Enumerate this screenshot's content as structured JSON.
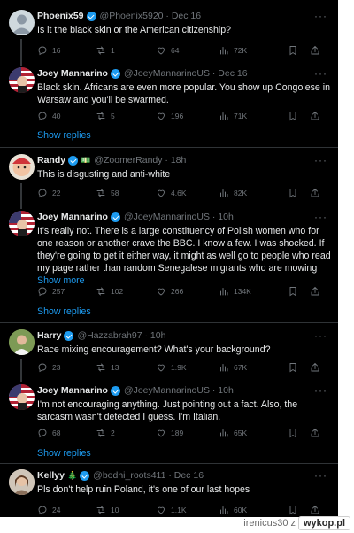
{
  "colors": {
    "background": "#000000",
    "text_primary": "#e7e9ea",
    "text_secondary": "#71767b",
    "accent": "#1d9bf0",
    "divider": "#2f3336"
  },
  "tweets": [
    {
      "name": "Phoenix59",
      "verified": true,
      "handle": "@Phoenix5920 · Dec 16",
      "text": "Is it the black skin or the American citizenship?",
      "stats": {
        "replies": "16",
        "reposts": "1",
        "likes": "64",
        "views": "72K"
      }
    },
    {
      "name": "Joey Mannarino",
      "verified": true,
      "handle": "@JoeyMannarinoUS · Dec 16",
      "text": "Black skin. Africans are even more popular. You show up Congolese in Warsaw and you'll be swarmed.",
      "stats": {
        "replies": "40",
        "reposts": "5",
        "likes": "196",
        "views": "71K"
      },
      "show_replies": "Show replies"
    },
    {
      "name": "Randy",
      "verified": true,
      "handle": "@ZoomerRandy · 18h",
      "text": "This is disgusting and anti-white",
      "stats": {
        "replies": "22",
        "reposts": "58",
        "likes": "4.6K",
        "views": "82K"
      }
    },
    {
      "name": "Joey Mannarino",
      "verified": true,
      "handle": "@JoeyMannarinoUS · 10h",
      "text": "It's really not. There is a large constituency of Polish women who for one reason or another crave the BBC. I know a few. I was shocked. If they're going to get it either way, it might as well go to people who read my page rather than random Senegalese migrants who are mowing",
      "show_more": "Show more",
      "stats": {
        "replies": "257",
        "reposts": "102",
        "likes": "266",
        "views": "134K"
      },
      "show_replies": "Show replies"
    },
    {
      "name": "Harry",
      "verified": true,
      "handle": "@Hazzabrah97 · 10h",
      "text": "Race mixing encouragement? What's your background?",
      "stats": {
        "replies": "23",
        "reposts": "13",
        "likes": "1.9K",
        "views": "67K"
      }
    },
    {
      "name": "Joey Mannarino",
      "verified": true,
      "handle": "@JoeyMannarinoUS · 10h",
      "text": "I'm not encouraging anything. Just pointing out a fact. Also, the sarcasm wasn't detected I guess. I'm Italian.",
      "stats": {
        "replies": "68",
        "reposts": "2",
        "likes": "189",
        "views": "65K"
      },
      "show_replies": "Show replies"
    },
    {
      "name": "Kellyy",
      "verified": true,
      "handle": "@bodhi_roots411 · Dec 16",
      "text": "Pls don't help ruin Poland, it's one of our last hopes",
      "stats": {
        "replies": "24",
        "reposts": "10",
        "likes": "1.1K",
        "views": "60K"
      }
    }
  ],
  "watermark": {
    "user": "irenicus30",
    "separator": "z",
    "site": "wykop.pl"
  }
}
